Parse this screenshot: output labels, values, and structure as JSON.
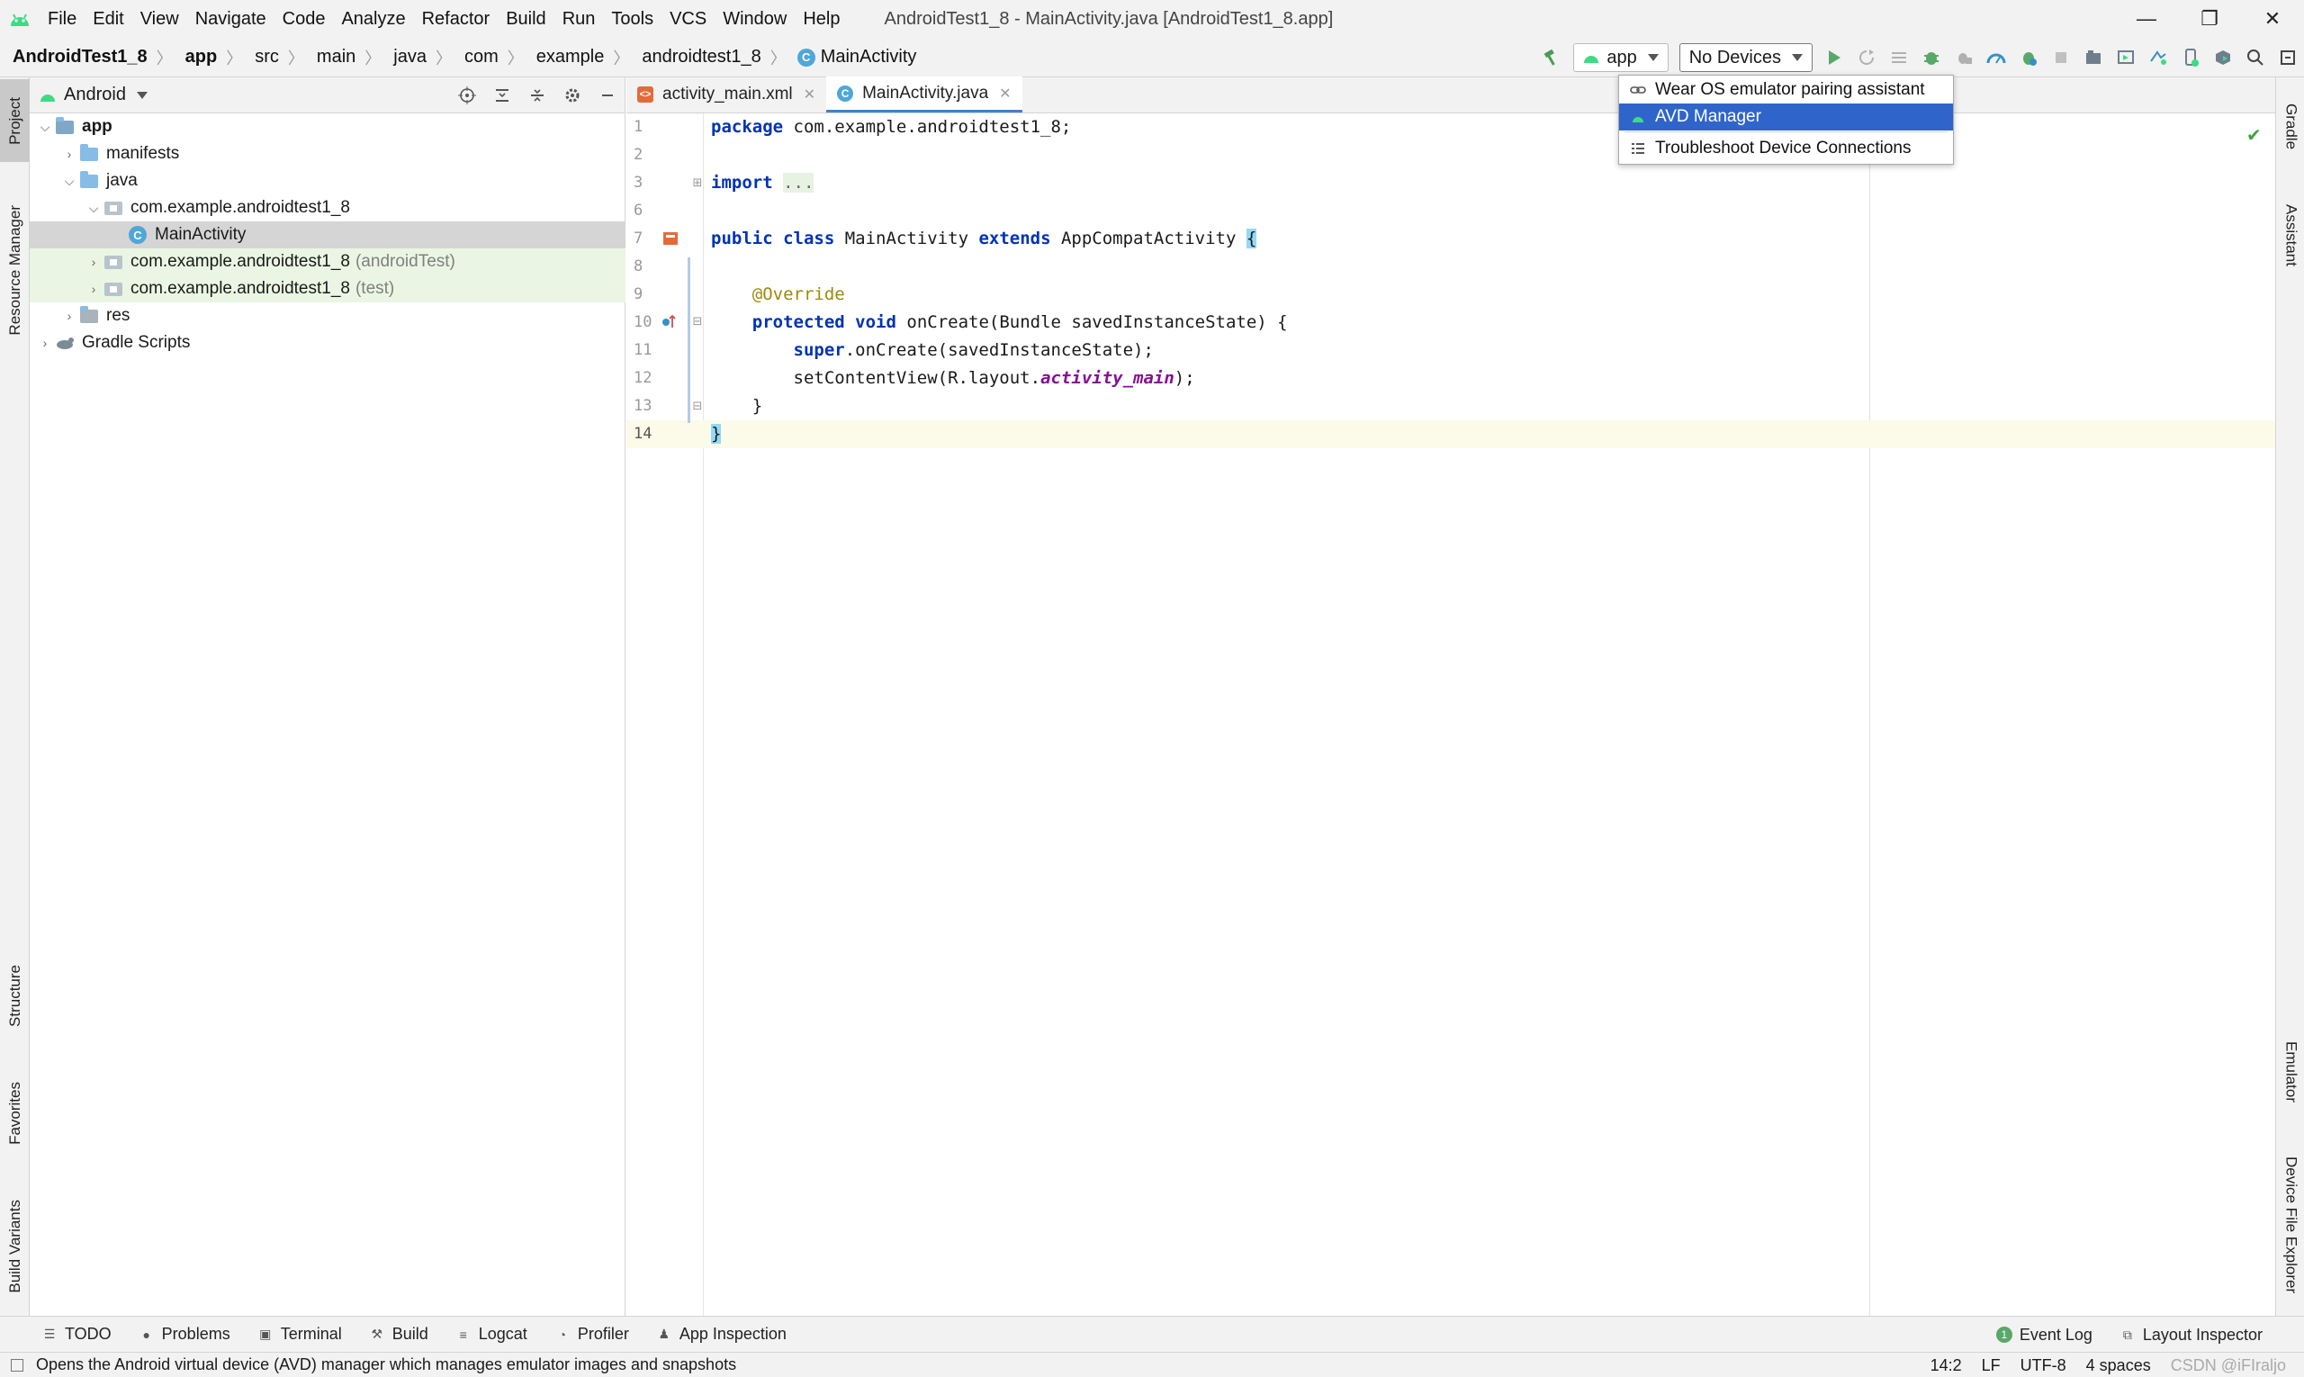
{
  "window": {
    "title": "AndroidTest1_8 - MainActivity.java [AndroidTest1_8.app]",
    "controls": {
      "minimize": "—",
      "restore": "❐",
      "close": "✕"
    }
  },
  "menu": [
    "File",
    "Edit",
    "View",
    "Navigate",
    "Code",
    "Analyze",
    "Refactor",
    "Build",
    "Run",
    "Tools",
    "VCS",
    "Window",
    "Help"
  ],
  "breadcrumb": [
    "AndroidTest1_8",
    "app",
    "src",
    "main",
    "java",
    "com",
    "example",
    "androidtest1_8",
    "MainActivity"
  ],
  "toolbar": {
    "run_config": "app",
    "device_selector": "No Devices",
    "icons": [
      "hammer-icon",
      "android-icon",
      "run-icon",
      "rerun-icon",
      "apply-changes-icon",
      "debug-icon",
      "attach-debugger-icon",
      "profile-icon",
      "coverage-icon",
      "stop-icon",
      "project-structure-icon",
      "device-manager-icon",
      "sync-icon",
      "avd-icon",
      "sdk-icon",
      "search-icon",
      "settings-icon"
    ]
  },
  "device_dropdown": {
    "items": [
      {
        "label": "Wear OS emulator pairing assistant",
        "icon": "link-icon",
        "highlighted": false
      },
      {
        "label": "AVD Manager",
        "icon": "android-phone-icon",
        "highlighted": true
      },
      {
        "label": "Troubleshoot Device Connections",
        "icon": "list-icon",
        "highlighted": false
      }
    ]
  },
  "left_stripe": [
    "Project",
    "Resource Manager",
    "Structure",
    "Favorites",
    "Build Variants"
  ],
  "right_stripe": [
    "Gradle",
    "Assistant",
    "Emulator",
    "Device File Explorer"
  ],
  "project_panel": {
    "view": "Android",
    "header_icons": [
      "locate-icon",
      "expand-all-icon",
      "collapse-all-icon",
      "gear-icon",
      "hide-icon"
    ],
    "tree": [
      {
        "label": "app",
        "suffix": "",
        "depth": 0,
        "expanded": true,
        "icon": "module"
      },
      {
        "label": "manifests",
        "suffix": "",
        "depth": 1,
        "expanded": false,
        "icon": "folder"
      },
      {
        "label": "java",
        "suffix": "",
        "depth": 1,
        "expanded": true,
        "icon": "folder"
      },
      {
        "label": "com.example.androidtest1_8",
        "suffix": "",
        "depth": 2,
        "expanded": true,
        "icon": "package"
      },
      {
        "label": "MainActivity",
        "suffix": "",
        "depth": 3,
        "expanded": null,
        "icon": "class",
        "selected": true
      },
      {
        "label": "com.example.androidtest1_8",
        "suffix": "(androidTest)",
        "depth": 2,
        "expanded": false,
        "icon": "package",
        "test": true
      },
      {
        "label": "com.example.androidtest1_8",
        "suffix": "(test)",
        "depth": 2,
        "expanded": false,
        "icon": "package",
        "test": true
      },
      {
        "label": "res",
        "suffix": "",
        "depth": 1,
        "expanded": false,
        "icon": "res-folder"
      },
      {
        "label": "Gradle Scripts",
        "suffix": "",
        "depth": 0,
        "expanded": false,
        "icon": "gradle"
      }
    ]
  },
  "editor": {
    "tabs": [
      {
        "label": "activity_main.xml",
        "active": false,
        "icon": "xml-icon"
      },
      {
        "label": "MainActivity.java",
        "active": true,
        "icon": "class-icon"
      }
    ],
    "line_numbers": [
      "1",
      "2",
      "3",
      "6",
      "7",
      "8",
      "9",
      "10",
      "11",
      "12",
      "13",
      "14"
    ],
    "current_line": "14",
    "code": {
      "l1_kw": "package",
      "l1_rest": " com.example.androidtest1_8;",
      "l3_kw": "import",
      "l3_fold": "...",
      "l7_kw1": "public",
      "l7_kw2": "class",
      "l7_name": " MainActivity ",
      "l7_kw3": "extends",
      "l7_base": " AppCompatActivity ",
      "l7_brace": "{",
      "l9_ann": "@Override",
      "l10_kw1": "protected",
      "l10_kw2": "void",
      "l10_rest": " onCreate(Bundle savedInstanceState) {",
      "l11_kw": "super",
      "l11_rest": ".onCreate(savedInstanceState);",
      "l12_a": "setContentView(R.layout.",
      "l12_field": "activity_main",
      "l12_b": ");",
      "l13": "}",
      "l14": "}"
    }
  },
  "bottom_tools": {
    "left": [
      {
        "label": "TODO",
        "icon": "list-icon"
      },
      {
        "label": "Problems",
        "icon": "problems-icon"
      },
      {
        "label": "Terminal",
        "icon": "terminal-icon"
      },
      {
        "label": "Build",
        "icon": "hammer-icon"
      },
      {
        "label": "Logcat",
        "icon": "logcat-icon"
      },
      {
        "label": "Profiler",
        "icon": "profiler-icon"
      },
      {
        "label": "App Inspection",
        "icon": "inspection-icon"
      }
    ],
    "right": [
      {
        "label": "Event Log",
        "icon": "event-log-icon",
        "badge": "1"
      },
      {
        "label": "Layout Inspector",
        "icon": "layout-inspector-icon"
      }
    ]
  },
  "status_bar": {
    "message": "Opens the Android virtual device (AVD) manager which manages emulator images and snapshots",
    "position": "14:2",
    "line_sep": "LF",
    "encoding": "UTF-8",
    "indent": "4 spaces",
    "watermark": "CSDN @iFIraljo"
  },
  "colors": {
    "accent": "#2f65ca",
    "android_green": "#3ddc84",
    "keyword": "#0033b3",
    "annotation": "#9e880d",
    "field": "#871094"
  }
}
